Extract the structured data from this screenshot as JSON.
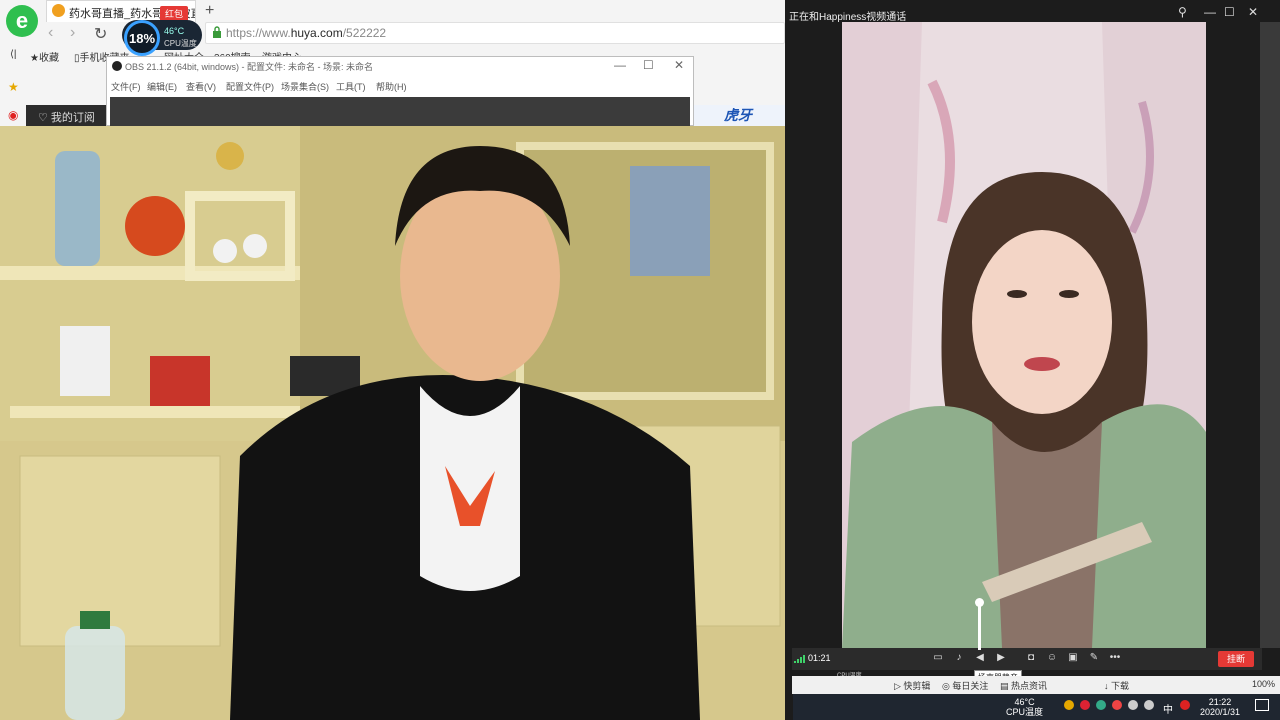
{
  "browser": {
    "tab_title": "药水哥直播_药水哥s刘波直",
    "red_packet_label": "红包",
    "new_tab": "+",
    "url_scheme": "https://www.",
    "url_domain": "huya.com",
    "url_path": "/522222",
    "cpu_percent": "18%",
    "cpu_temp": "46°C",
    "cpu_label": "CPU温度",
    "bookmarks": [
      "收藏",
      "手机收藏夹",
      "网址大全",
      "360搜索",
      "游戏中心"
    ],
    "subscribe_label": "我的订阅"
  },
  "obs": {
    "title": "OBS 21.1.2 (64bit, windows) - 配置文件: 未命名 - 场景: 未命名",
    "menu": [
      "文件(F)",
      "编辑(E)",
      "查看(V)",
      "配置文件(P)",
      "场景集合(S)",
      "工具(T)",
      "帮助(H)"
    ]
  },
  "video_call": {
    "title": "正在和Happiness视频通话",
    "duration": "01:21",
    "hangup_label": "挂断",
    "tooltip": "扬声器静音",
    "volume_level": 1.0
  },
  "strip": {
    "items": [
      "快剪辑",
      "每日关注",
      "热点资讯",
      "下载"
    ],
    "zoom": "100%"
  },
  "taskbar": {
    "temp": "46°C",
    "temp_label": "CPU温度",
    "ime": "中",
    "time": "21:22",
    "date": "2020/1/31"
  },
  "colors": {
    "accent_green": "#2fbf4f",
    "hangup_red": "#e53935"
  }
}
